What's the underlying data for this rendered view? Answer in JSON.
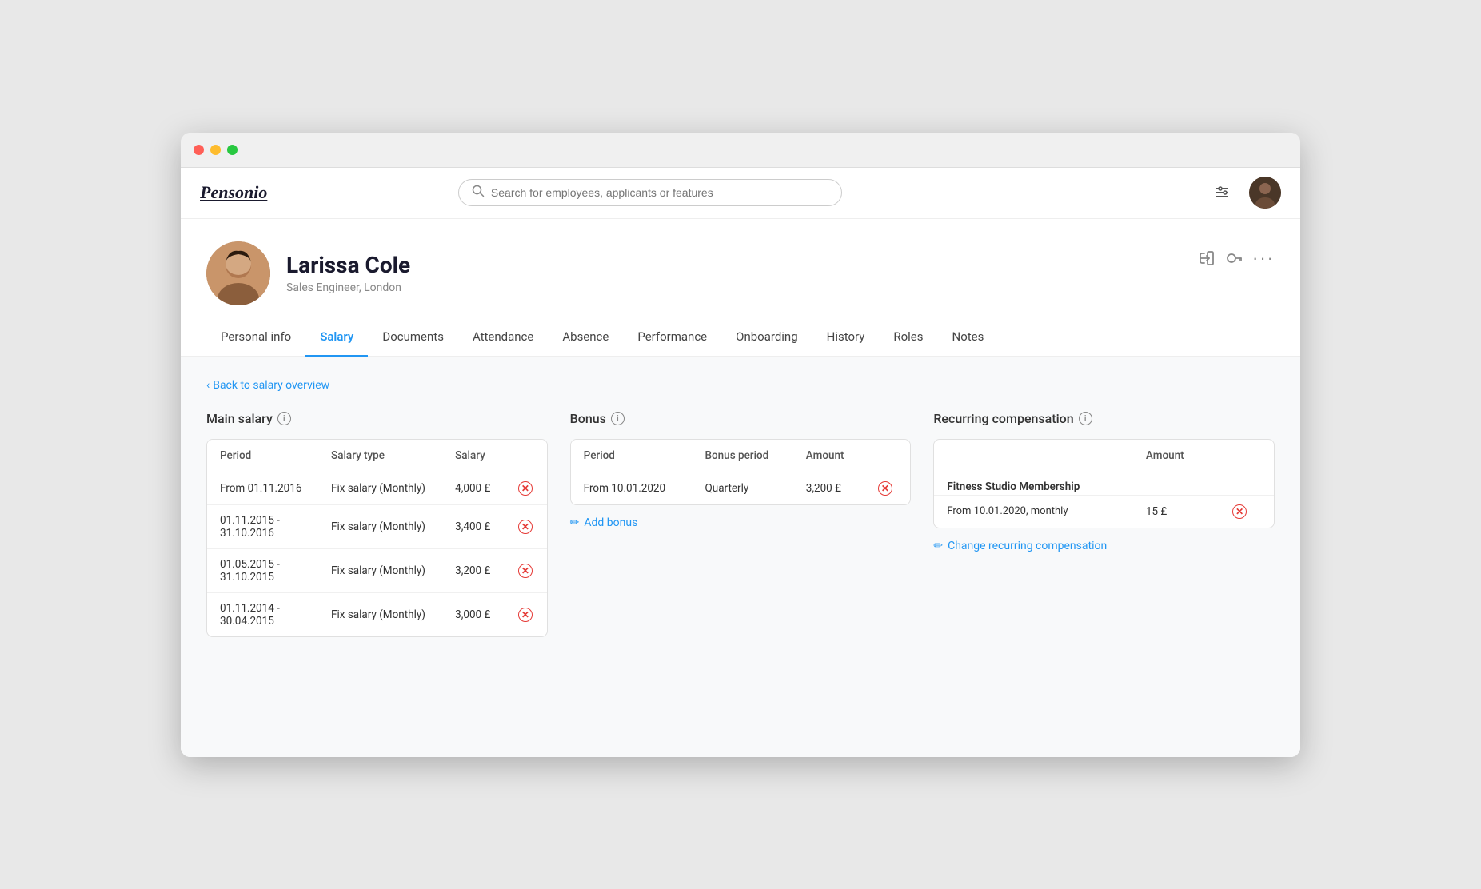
{
  "window": {
    "title": "Personio"
  },
  "navbar": {
    "logo": "Pensonio",
    "search_placeholder": "Search for employees, applicants or features"
  },
  "profile": {
    "name": "Larissa Cole",
    "subtitle": "Sales Engineer, London"
  },
  "tabs": [
    {
      "id": "personal-info",
      "label": "Personal info",
      "active": false
    },
    {
      "id": "salary",
      "label": "Salary",
      "active": true
    },
    {
      "id": "documents",
      "label": "Documents",
      "active": false
    },
    {
      "id": "attendance",
      "label": "Attendance",
      "active": false
    },
    {
      "id": "absence",
      "label": "Absence",
      "active": false
    },
    {
      "id": "performance",
      "label": "Performance",
      "active": false
    },
    {
      "id": "onboarding",
      "label": "Onboarding",
      "active": false
    },
    {
      "id": "history",
      "label": "History",
      "active": false
    },
    {
      "id": "roles",
      "label": "Roles",
      "active": false
    },
    {
      "id": "notes",
      "label": "Notes",
      "active": false
    }
  ],
  "back_link": "Back to salary overview",
  "main_salary": {
    "title": "Main salary",
    "columns": [
      "Period",
      "Salary type",
      "Salary"
    ],
    "rows": [
      {
        "period": "From 01.11.2016",
        "type": "Fix salary (Monthly)",
        "salary": "4,000 £"
      },
      {
        "period": "01.11.2015 - 31.10.2016",
        "type": "Fix salary (Monthly)",
        "salary": "3,400 £"
      },
      {
        "period": "01.05.2015 - 31.10.2015",
        "type": "Fix salary (Monthly)",
        "salary": "3,200 £"
      },
      {
        "period": "01.11.2014 - 30.04.2015",
        "type": "Fix salary (Monthly)",
        "salary": "3,000 £"
      }
    ]
  },
  "bonus": {
    "title": "Bonus",
    "columns": [
      "Period",
      "Bonus period",
      "Amount"
    ],
    "rows": [
      {
        "period": "From 10.01.2020",
        "bonus_period": "Quarterly",
        "amount": "3,200 £"
      }
    ],
    "add_label": "Add bonus"
  },
  "recurring": {
    "title": "Recurring compensation",
    "columns": [
      "",
      "Amount"
    ],
    "items": [
      {
        "label": "Fitness Studio Membership",
        "sub": "From 10.01.2020, monthly",
        "amount": "15 £"
      }
    ],
    "change_label": "Change recurring compensation"
  }
}
